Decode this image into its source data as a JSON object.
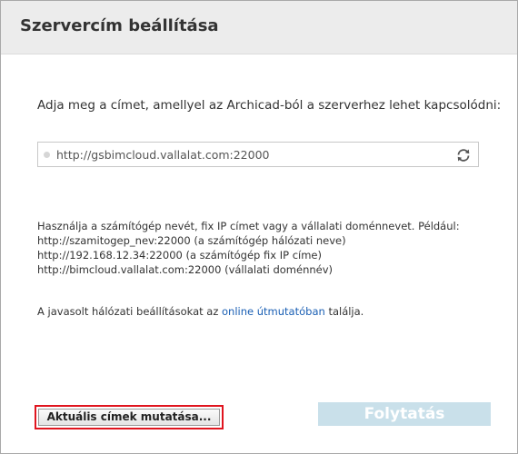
{
  "dialog": {
    "title": "Szervercím beállítása",
    "prompt": "Adja meg a címet, amellyel az Archicad-ból a szerverhez lehet kapcsolódni:",
    "address_value": "http://gsbimcloud.vallalat.com:22000",
    "refresh_icon": "refresh-icon",
    "hints": [
      "Használja a számítógép nevét, fix IP címet vagy a vállalati doménnevet. Például:",
      "http://szamitogep_nev:22000 (a számítógép hálózati neve)",
      "http://192.168.12.34:22000 (a számítógép fix IP címe)",
      "http://bimcloud.vallalat.com:22000 (vállalati doménnév)"
    ],
    "guide_prefix": "A javasolt hálózati beállításokat az",
    "guide_link": "online útmutatóban",
    "guide_suffix": "találja.",
    "show_addresses_label": "Aktuális címek mutatása...",
    "continue_label": "Folytatás",
    "colors": {
      "link": "#1a5fb4",
      "continue_disabled": "#c9e0ea",
      "highlight_border": "#e0151f"
    }
  }
}
